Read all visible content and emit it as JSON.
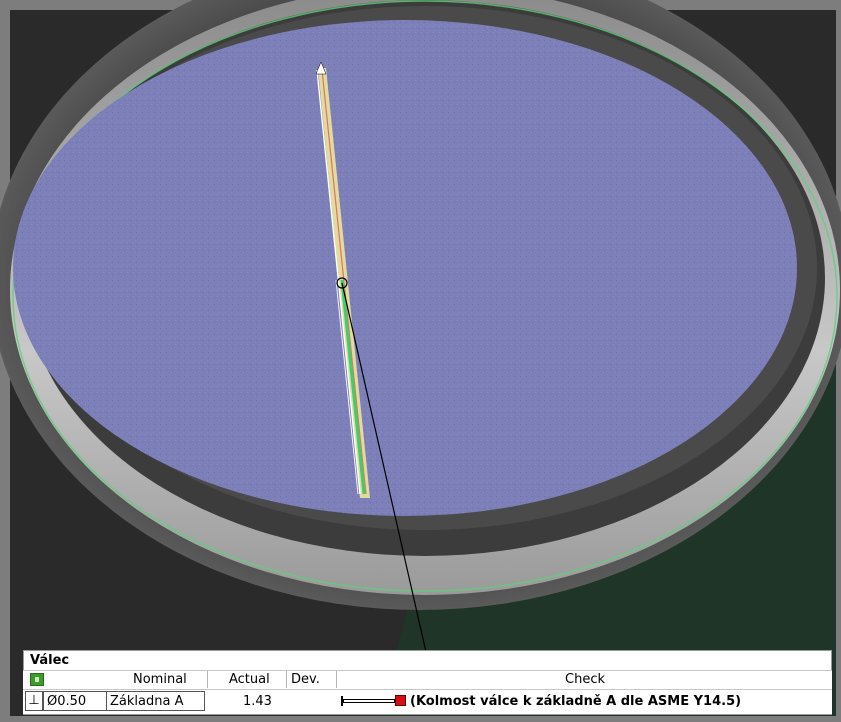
{
  "panel": {
    "title": "Válec",
    "headers": {
      "nominal": "Nominal",
      "actual": "Actual",
      "dev": "Dev.",
      "check": "Check"
    },
    "row": {
      "symbol": "⊥",
      "tolerance": "Ø0.50",
      "datum": "Základna A",
      "actual": "1.43",
      "dev": "",
      "check_text": "(Kolmost válce k základně A dle ASME Y14.5)"
    }
  },
  "colors": {
    "status_ok": "#3e9a2c",
    "deviation_marker": "#d4101a",
    "cylinder_face": "#7c7fb8",
    "background_dark": "#1f3527"
  },
  "icons": {
    "status": "status-square-icon",
    "perpendicularity": "perpendicularity-icon",
    "deviation_marker": "deviation-marker-icon"
  }
}
